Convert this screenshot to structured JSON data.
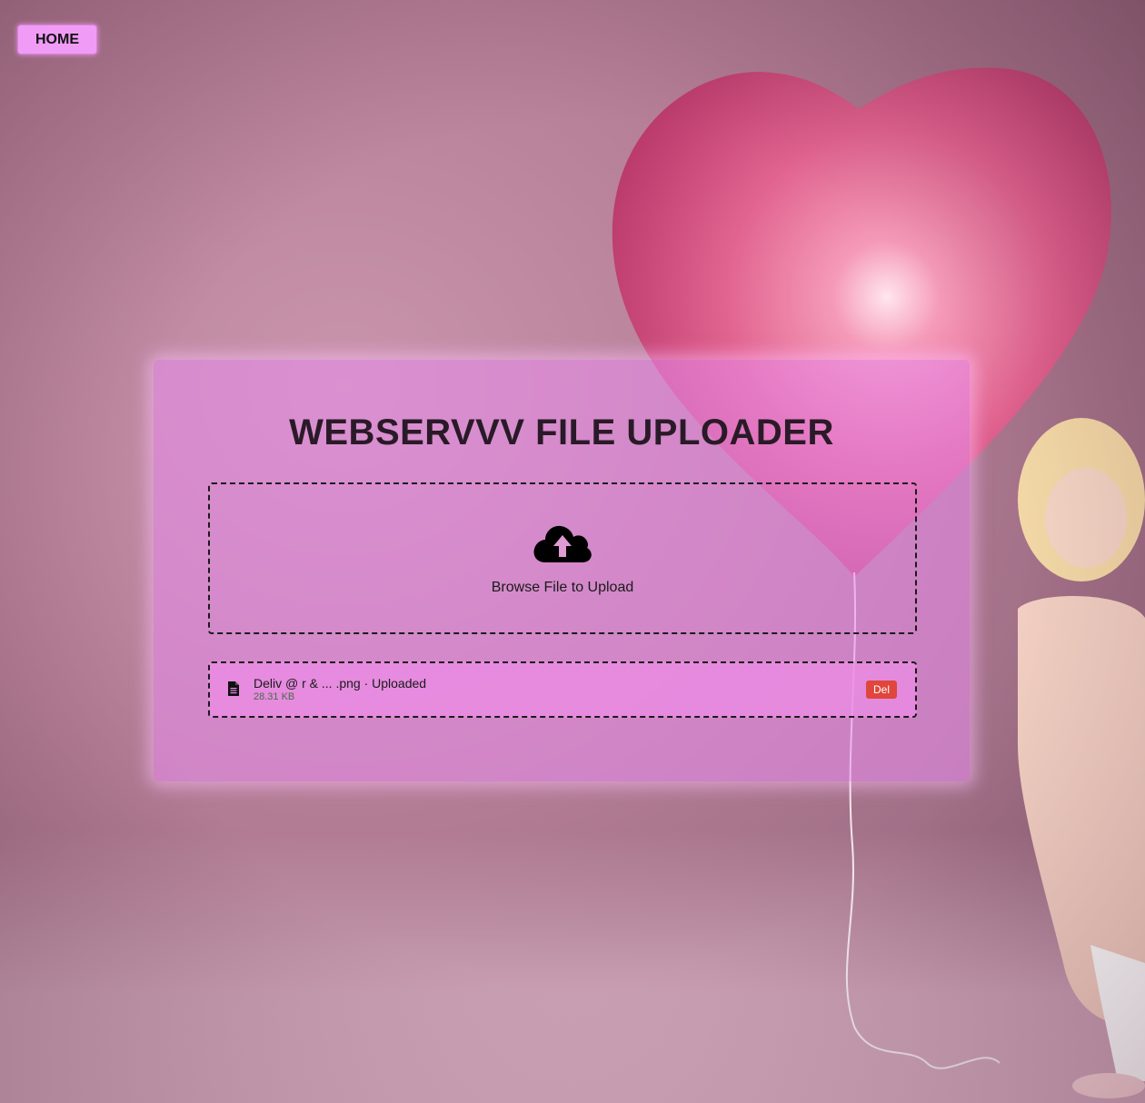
{
  "nav": {
    "home_label": "HOME"
  },
  "uploader": {
    "title": "WEBSERVVV FILE UPLOADER",
    "dropzone_label": "Browse File to Upload",
    "files": [
      {
        "name": "Deliv @ r & ... .png · Uploaded",
        "size": "28.31 KB",
        "delete_label": "Del"
      }
    ]
  },
  "colors": {
    "accent": "#f09cf6",
    "card": "#e98cee",
    "delete": "#e0463c"
  },
  "icons": {
    "upload": "cloud-upload-icon",
    "file": "file-icon"
  }
}
